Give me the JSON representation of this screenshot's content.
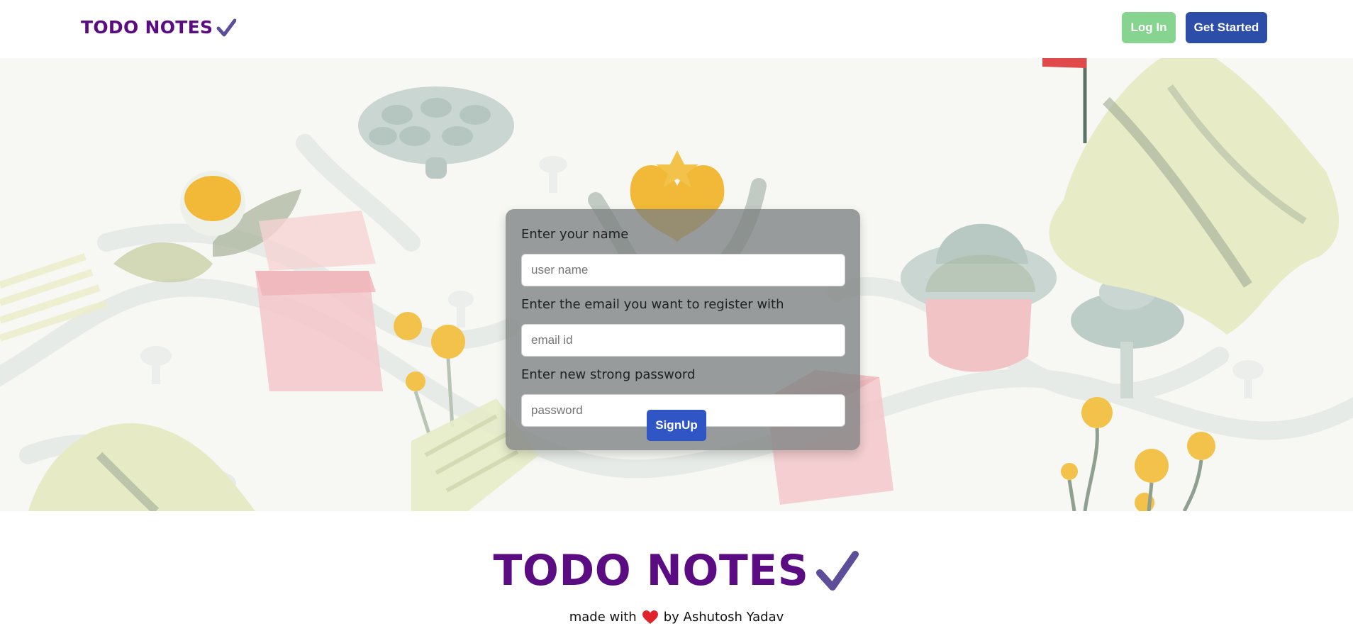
{
  "navbar": {
    "brand": "TODO NOTES",
    "login_label": "Log In",
    "get_started_label": "Get Started"
  },
  "form": {
    "name_label": "Enter your name",
    "name_placeholder": "user name",
    "email_label": "Enter the email you want to register with",
    "email_placeholder": "email id",
    "password_label": "Enter new strong password",
    "password_placeholder": "password",
    "signup_label": "SignUp"
  },
  "footer": {
    "title": "TODO NOTES",
    "credit_prefix": "made with",
    "credit_suffix": "by Ashutosh Yadav"
  },
  "icons": {
    "brand_check": "check-icon",
    "footer_check": "check-icon",
    "heart": "heart-icon"
  },
  "colors": {
    "brand_purple": "#5b0c82",
    "check_purple": "#5e4e9a",
    "login_green": "#86d48f",
    "started_blue": "#2d4ea8",
    "signup_blue": "#2f56c4",
    "heart_red": "#e0242e"
  }
}
